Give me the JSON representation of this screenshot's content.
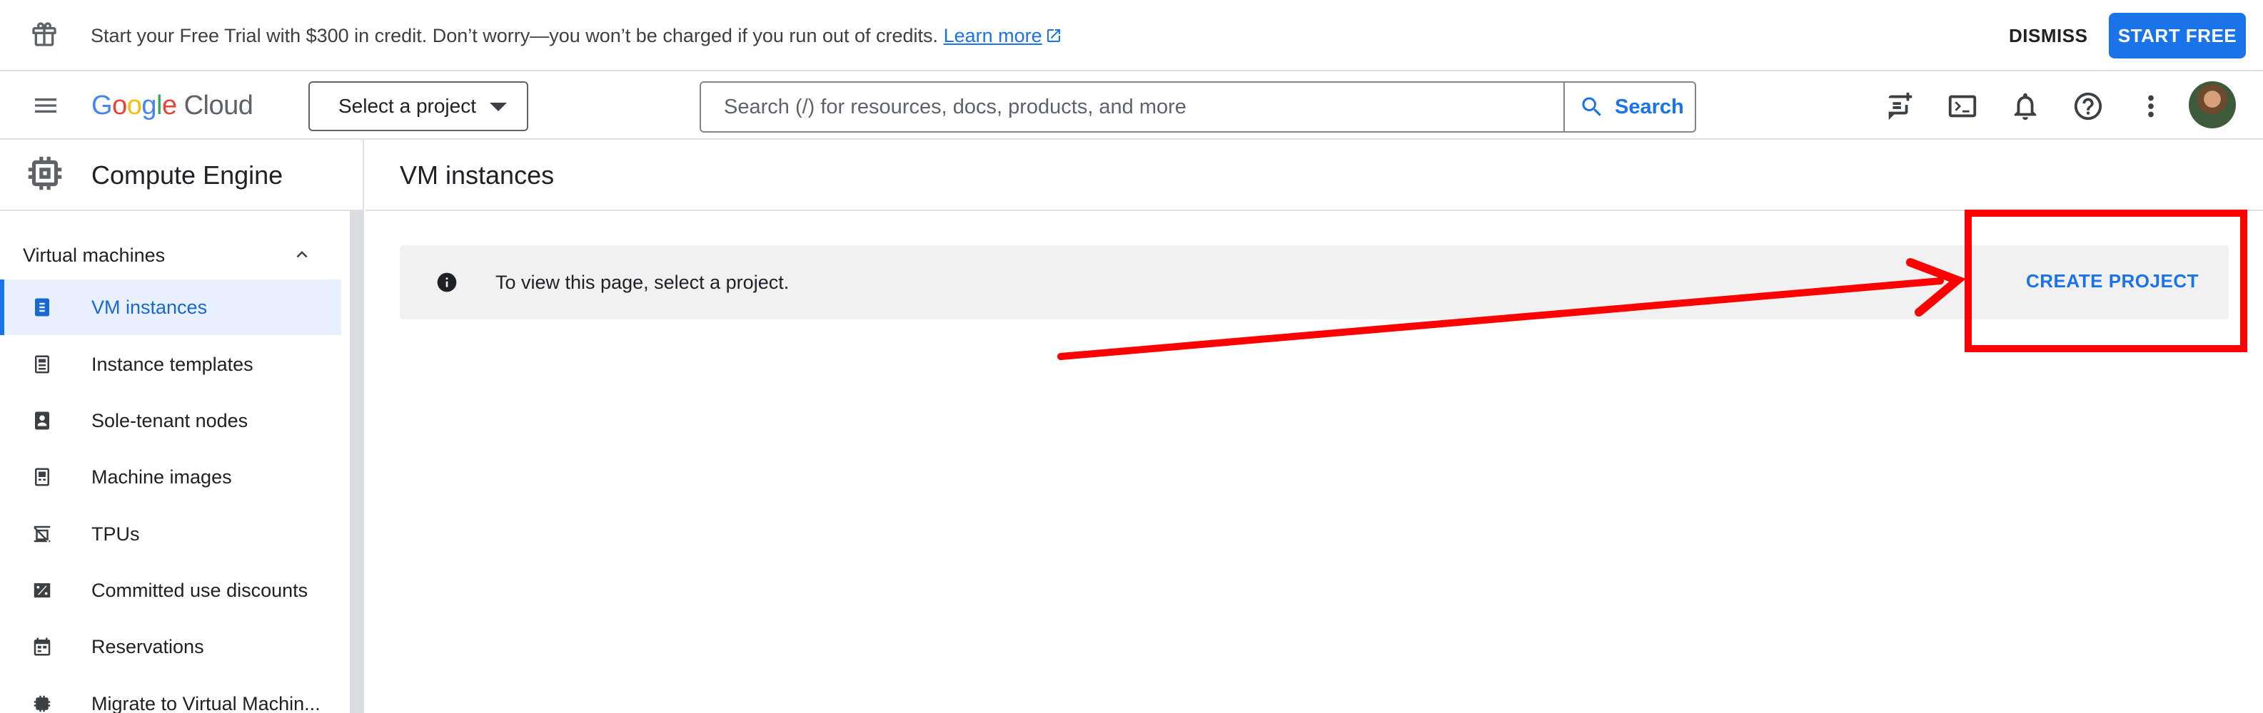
{
  "banner": {
    "icon": "gift-icon",
    "message": "Start your Free Trial with $300 in credit. Don’t worry—you won’t be charged if you run out of credits.",
    "learn_more": "Learn more",
    "dismiss_label": "DISMISS",
    "start_free_label": "START FREE",
    "accent_color": "#1a73e8"
  },
  "header": {
    "logo": {
      "letters": [
        "G",
        "o",
        "o",
        "g",
        "l",
        "e"
      ],
      "product": "Cloud"
    },
    "project_selector": "Select a project",
    "search": {
      "placeholder": "Search (/) for resources, docs, products, and more",
      "button_label": "Search"
    },
    "icons": [
      "feedback-icon",
      "cloud-shell-icon",
      "notifications-icon",
      "help-icon",
      "more-vert-icon",
      "avatar"
    ]
  },
  "product": {
    "name": "Compute Engine",
    "icon": "compute-chip-icon"
  },
  "sidebar": {
    "section": "Virtual machines",
    "items": [
      {
        "label": "VM instances",
        "icon": "vm-instance-icon",
        "active": true
      },
      {
        "label": "Instance templates",
        "icon": "template-icon",
        "active": false
      },
      {
        "label": "Sole-tenant nodes",
        "icon": "sole-tenant-icon",
        "active": false
      },
      {
        "label": "Machine images",
        "icon": "machine-image-icon",
        "active": false
      },
      {
        "label": "TPUs",
        "icon": "tpu-icon",
        "active": false
      },
      {
        "label": "Committed use discounts",
        "icon": "percent-icon",
        "active": false
      },
      {
        "label": "Reservations",
        "icon": "calendar-icon",
        "active": false
      },
      {
        "label": "Migrate to Virtual Machin...",
        "icon": "migrate-icon",
        "active": false
      }
    ]
  },
  "main": {
    "page_title": "VM instances",
    "info": {
      "text": "To view this page, select a project.",
      "action_label": "CREATE PROJECT",
      "icon": "info-icon"
    }
  },
  "annotation": {
    "color": "#ff0000"
  }
}
